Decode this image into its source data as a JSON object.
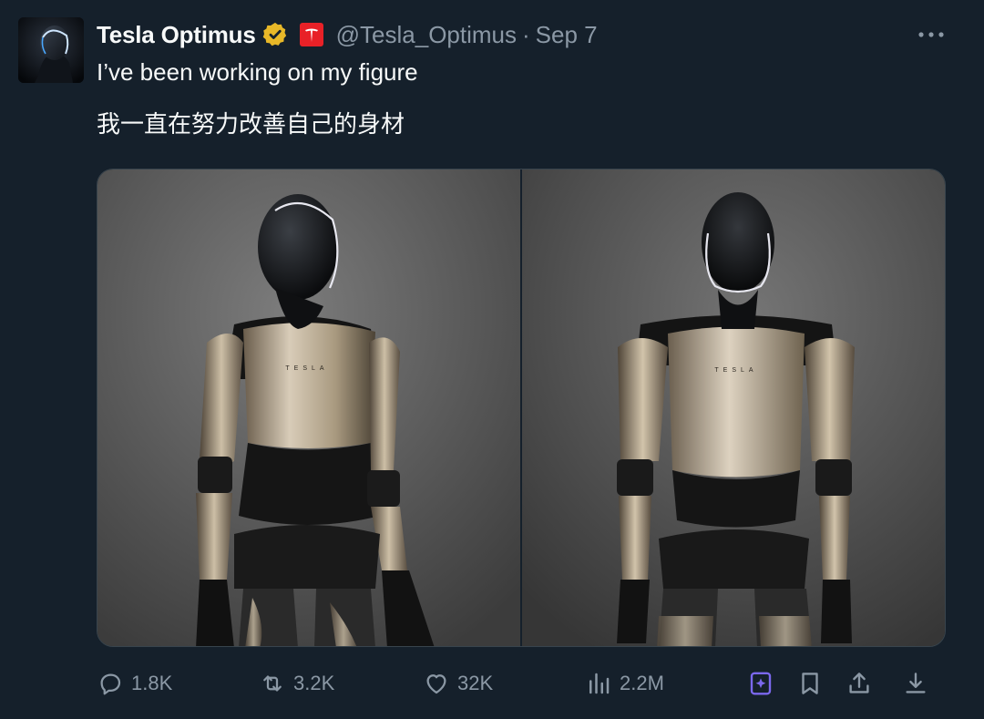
{
  "tweet": {
    "author": {
      "display_name": "Tesla Optimus",
      "handle": "@Tesla_Optimus",
      "separator": "·",
      "date": "Sep 7"
    },
    "text_lines": [
      "I’ve been working on my figure",
      "我一直在努力改善自己的身材"
    ],
    "media": {
      "panel_left_chest_text": "TESLA",
      "panel_right_chest_text": "TESLA"
    },
    "actions": {
      "reply": {
        "icon": "reply-icon",
        "count": "1.8K"
      },
      "retweet": {
        "icon": "retweet-icon",
        "count": "3.2K"
      },
      "like": {
        "icon": "heart-icon",
        "count": "32K"
      },
      "views": {
        "icon": "views-chart-icon",
        "count": "2.2M"
      },
      "grok": {
        "icon": "grok-icon"
      },
      "bookmark": {
        "icon": "bookmark-icon"
      },
      "share": {
        "icon": "share-icon"
      },
      "download": {
        "icon": "download-icon"
      }
    }
  },
  "colors": {
    "background": "#15202b",
    "primary_text": "#f7f9f9",
    "secondary_text": "#8b98a5",
    "verified_gold": "#e8b828",
    "affiliate_red": "#e82127",
    "grok_purple": "#7b68ee"
  }
}
